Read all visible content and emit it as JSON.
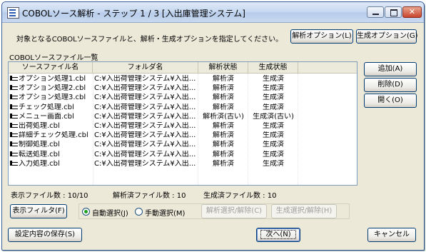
{
  "window": {
    "title": "COBOLソース解析 - ステップ 1 / 3 [入出庫管理システム]"
  },
  "instruction": "対象となるCOBOLソースファイルと、解析・生成オプションを指定してください。",
  "buttons": {
    "analysis_options": "解析オプション(L)",
    "generation_options": "生成オプション(G)",
    "add": "追加(A)",
    "delete": "削除(D)",
    "open": "開く(O)",
    "display_filter": "表示フィルタ(F)",
    "analysis_select_clear": "解析選択/解除(C)",
    "generation_select_clear": "生成選択/解除(H)",
    "save_settings": "設定内容の保存(S)",
    "next": "次へ(N)",
    "cancel": "キャンセル"
  },
  "list": {
    "caption": "COBOLソースファイル一覧",
    "columns": [
      "ソースファイル名",
      "フォルダ名",
      "解析状態",
      "生成状態"
    ],
    "rows": [
      [
        "オプション処理1.cbl",
        "C:¥入出荷管理システム¥入出...",
        "解析済",
        "生成済"
      ],
      [
        "オプション処理2.cbl",
        "C:¥入出荷管理システム¥入出...",
        "解析済",
        "生成済"
      ],
      [
        "オプション処理3.cbl",
        "C:¥入出荷管理システム¥入出...",
        "解析済",
        "生成済"
      ],
      [
        "チェック処理.cbl",
        "C:¥入出荷管理システム¥入出...",
        "解析済",
        "生成済"
      ],
      [
        "メニュー画面.cbl",
        "C:¥入出荷管理システム¥入出...",
        "解析済(古い)",
        "生成済(古い)"
      ],
      [
        "出荷処理.cbl",
        "C:¥入出荷管理システム¥入出...",
        "解析済",
        "生成済"
      ],
      [
        "詳細チェック処理.cbl",
        "C:¥入出荷管理システム¥入出...",
        "解析済",
        "生成済"
      ],
      [
        "制御処理.cbl",
        "C:¥入出荷管理システム¥入出...",
        "解析済",
        "生成済"
      ],
      [
        "転送処理.cbl",
        "C:¥入出荷管理システム¥入出...",
        "解析済",
        "生成済"
      ],
      [
        "入力処理.cbl",
        "C:¥入出荷管理システム¥入出...",
        "解析済",
        "生成済"
      ]
    ]
  },
  "stats": {
    "display_count": "表示ファイル数 : 10/10",
    "analyzed_count": "解析済ファイル数 : 10",
    "generated_count": "生成済ファイル数 : 10"
  },
  "selection_mode": {
    "auto_label": "自動選択(J)",
    "manual_label": "手動選択(M)",
    "selected": "auto"
  },
  "colors": {
    "title_bar": "#c9daf1",
    "window_bg": "#ece9d8",
    "list_border": "#7f9db9",
    "radio_dot": "#21a121"
  }
}
